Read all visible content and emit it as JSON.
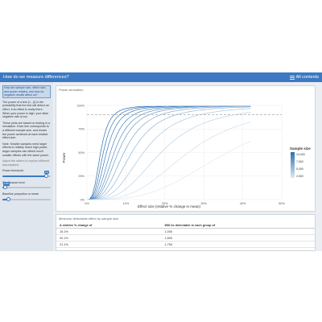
{
  "header": {
    "title": "How do we measure differences?",
    "menu_label": "All contents"
  },
  "sidebar": {
    "intro_highlight": "How are sample size, effect size, and power related, and how do negative results affect us?",
    "para1": "The power of a test (1 - β) is the probability that the test will detect an effect, if an effect is really there. When your power is high, your false negative rate is low.",
    "para2": "These plots are based on testing in a simulation. Each line corresponds to a different sample size, and shows the power achieved at each relative effect size.",
    "para3": "Note: Smaller samples need larger effects to reliably reach high power; larger samples can detect much smaller effects with the same power.",
    "muted_note": "Adjust the sliders to explore different assumptions.",
    "slider1": {
      "label": "Power threshold",
      "value_text": "0.9",
      "fraction": 0.9
    },
    "slider2": {
      "label": "Significance level",
      "value_text": "0.05",
      "fraction": 0.05
    },
    "slider3": {
      "label": "Baseline proportion or mean",
      "value_text": "",
      "fraction": 0.12
    }
  },
  "plot": {
    "panel_title": "Power simulation",
    "xlabel": "Effect size (relative % change in mean)",
    "ylabel": "Power",
    "legend_title": "Sample size",
    "legend_entries": [
      "10,000",
      "7,500",
      "5,000",
      "2,500"
    ]
  },
  "table": {
    "panel_title": "Minimum detectable effect by sample size",
    "headers": [
      "A relative % change of",
      "Will be detectable in each group of"
    ],
    "rows": [
      [
        "15.1%",
        "1,000"
      ],
      [
        "20.1%",
        "1,500"
      ],
      [
        "21.1%",
        "1,750"
      ]
    ]
  },
  "colors": {
    "navbar": "#3c79c2",
    "sidebar_bg": "#dfe6ee",
    "accent": "#3c79c2",
    "line_dark": "#2c6fb0",
    "line_light": "#dfeaf3"
  },
  "chart_data": {
    "type": "line",
    "xlabel": "Effect size (relative % change in mean)",
    "ylabel": "Power",
    "x_ticks": [
      "0%",
      "10%",
      "20%",
      "30%",
      "40%",
      "50%"
    ],
    "y_ticks": [
      "0%",
      "25%",
      "50%",
      "75%",
      "100%"
    ],
    "xlim": [
      0,
      50
    ],
    "ylim": [
      0,
      1
    ],
    "threshold": 0.9,
    "grid": true,
    "legend_position": "right",
    "series": [
      {
        "x50": 3.5,
        "color": "#2c6fb0"
      },
      {
        "x50": 4.2,
        "color": "#3572b2"
      },
      {
        "x50": 5.0,
        "color": "#3e7ab6"
      },
      {
        "x50": 6.0,
        "color": "#4a83bb"
      },
      {
        "x50": 7.0,
        "color": "#5a8fc1"
      },
      {
        "x50": 8.0,
        "color": "#6b9bc8"
      },
      {
        "x50": 9.5,
        "color": "#7ea8cf"
      },
      {
        "x50": 11.5,
        "color": "#93b6d6"
      },
      {
        "x50": 14.5,
        "color": "#a9c5de"
      },
      {
        "x50": 19.0,
        "color": "#bed3e6"
      },
      {
        "x50": 26.0,
        "color": "#d0e0ed"
      },
      {
        "x50": 36.0,
        "color": "#dfeaf3"
      }
    ]
  }
}
